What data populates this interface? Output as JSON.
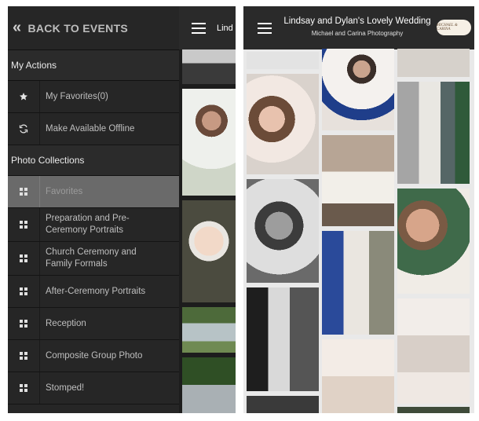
{
  "left_panel": {
    "back_label": "BACK TO EVENTS",
    "header_peek": "Lind",
    "my_actions_title": "My Actions",
    "actions": [
      {
        "label": "My Favorites(0)",
        "icon": "star-icon"
      },
      {
        "label": "Make Available Offline",
        "icon": "sync-icon"
      }
    ],
    "collections_title": "Photo Collections",
    "collections": [
      {
        "label": "Favorites",
        "selected": true
      },
      {
        "label": "Preparation and Pre-Ceremony Portraits"
      },
      {
        "label": "Church Ceremony and Family Formals"
      },
      {
        "label": "After-Ceremony Portraits"
      },
      {
        "label": "Reception"
      },
      {
        "label": "Composite Group Photo"
      },
      {
        "label": "Stomped!"
      }
    ]
  },
  "right_panel": {
    "title": "Lindsay and Dylan's Lovely Wedding",
    "subtitle": "Michael and Carina Photography",
    "logo_text": "MICHAEL & CARINA"
  },
  "colors": {
    "drawer_bg": "#262626",
    "selected_bg": "#6a6a6a",
    "topbar_bg": "#2a2a2a",
    "logo_bg": "#f6f0e6"
  }
}
